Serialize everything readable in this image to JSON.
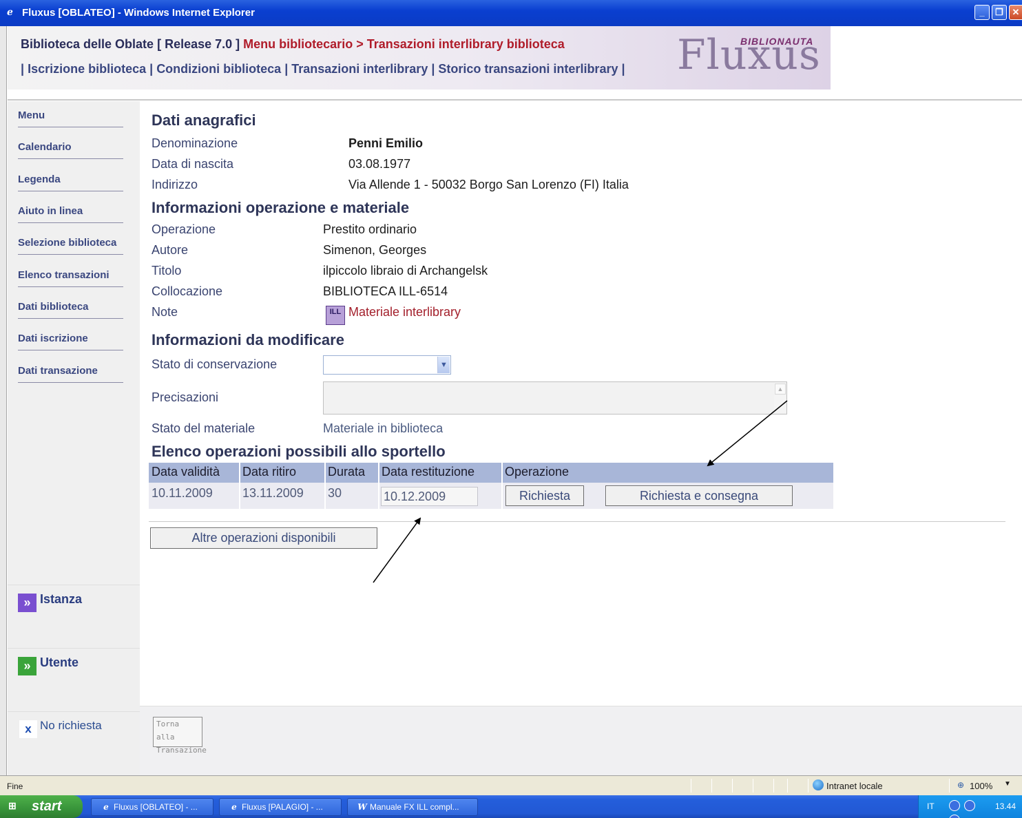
{
  "window": {
    "title": "Fluxus [OBLATEO] - Windows Internet Explorer",
    "min": "_",
    "max": "❐",
    "close": "✕"
  },
  "header": {
    "library": "Biblioteca delle Oblate",
    "release": "[ Release 7.0 ]",
    "menu": "Menu bibliotecario",
    "sep": ">",
    "current": "Transazioni interlibrary biblioteca",
    "nav_sep": "|",
    "nav": [
      "Iscrizione biblioteca",
      "Condizioni biblioteca",
      "Transazioni interlibrary",
      "Storico transazioni interlibrary"
    ],
    "logo_main": "Fluxus",
    "logo_sub": "BIBLIONAUTA"
  },
  "sidebar": {
    "items": [
      "Menu",
      "Calendario",
      "Legenda",
      "Aiuto in linea",
      "Selezione biblioteca",
      "Elenco transazioni",
      "Dati biblioteca",
      "Dati iscrizione",
      "Dati transazione"
    ],
    "panels": {
      "istanza": "Istanza",
      "utente": "Utente",
      "no_richiesta": "No richiesta",
      "panel_icon": "»",
      "x_icon": "x"
    },
    "colors": {
      "istanza_icon": "#7a4fd0",
      "utente_icon": "#3aa43a"
    }
  },
  "anagrafica": {
    "title": "Dati anagrafici",
    "labels": {
      "denominazione": "Denominazione",
      "nascita": "Data di nascita",
      "indirizzo": "Indirizzo"
    },
    "values": {
      "denominazione": "Penni Emilio",
      "nascita": "03.08.1977",
      "indirizzo": "Via Allende 1 - 50032 Borgo San Lorenzo (FI) Italia"
    }
  },
  "operazione": {
    "title": "Informazioni operazione e materiale",
    "labels": {
      "operazione": "Operazione",
      "autore": "Autore",
      "titolo": "Titolo",
      "collocazione": "Collocazione",
      "note": "Note"
    },
    "values": {
      "operazione": "Prestito ordinario",
      "autore": "Simenon, Georges",
      "titolo": "ilpiccolo libraio di Archangelsk",
      "collocazione": "BIBLIOTECA ILL-6514",
      "note": "Materiale interlibrary"
    },
    "note_icon": "ILL"
  },
  "modifica": {
    "title": "Informazioni da modificare",
    "labels": {
      "conservazione": "Stato di conservazione",
      "precisazioni": "Precisazioni",
      "stato": "Stato del materiale"
    },
    "conservazione_value": "",
    "precisazioni_value": "",
    "stato_value": "Materiale in biblioteca"
  },
  "sportello": {
    "title": "Elenco operazioni possibili allo sportello",
    "headers": [
      "Data validità",
      "Data ritiro",
      "Durata",
      "Data restituzione",
      "Operazione"
    ],
    "row": {
      "validita": "10.11.2009",
      "ritiro": "13.11.2009",
      "durata": "30",
      "restituzione": "10.12.2009"
    },
    "buttons": {
      "richiesta": "Richiesta",
      "richiesta_consegna": "Richiesta e consegna"
    },
    "altre": "Altre operazioni disponibili"
  },
  "bottom": {
    "torna_line1": "Torna alla",
    "torna_line2": "Transazione"
  },
  "statusbar": {
    "text": "Fine",
    "zone": "Intranet locale",
    "zoom": "100%"
  },
  "taskbar": {
    "start": "start",
    "tasks": [
      "Fluxus [OBLATEO] - ...",
      "Fluxus [PALAGIO] - ...",
      "Manuale FX ILL compl..."
    ],
    "lang": "IT",
    "clock": "13.44"
  }
}
